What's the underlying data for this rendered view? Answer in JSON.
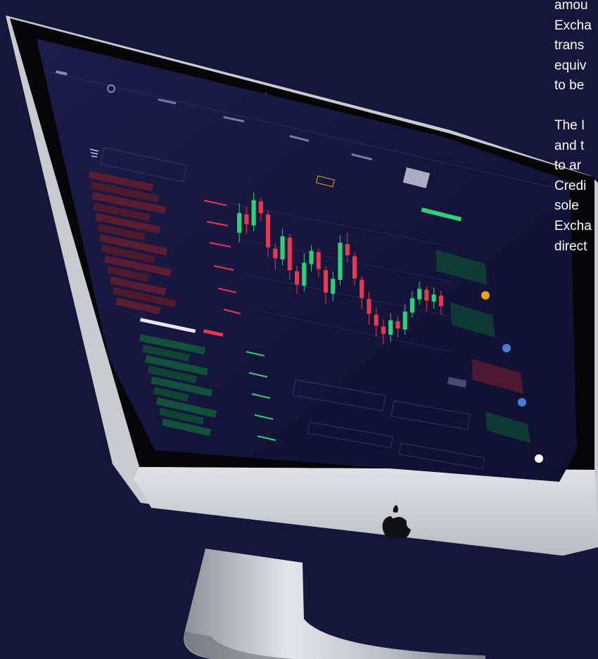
{
  "side_text": {
    "para1": [
      "amou",
      "Excha",
      "trans",
      "equiv",
      "to be"
    ],
    "para2": [
      "The I",
      "and t",
      "to ar",
      "Credi",
      "sole",
      "Excha",
      "direct"
    ]
  },
  "colors": {
    "background": "#16163a",
    "screen": "#121238",
    "bezel": "#0a0a0c",
    "chin": "#cfd3d8",
    "bull": "#2fd07a",
    "bear": "#e8384f",
    "accent": "#f0a020"
  },
  "chart_data": {
    "type": "candlestick",
    "candles": [
      {
        "o": 60,
        "c": 70,
        "h": 75,
        "l": 55
      },
      {
        "o": 70,
        "c": 65,
        "h": 74,
        "l": 60
      },
      {
        "o": 65,
        "c": 78,
        "h": 82,
        "l": 62
      },
      {
        "o": 78,
        "c": 72,
        "h": 80,
        "l": 68
      },
      {
        "o": 72,
        "c": 55,
        "h": 74,
        "l": 50
      },
      {
        "o": 55,
        "c": 50,
        "h": 58,
        "l": 44
      },
      {
        "o": 50,
        "c": 62,
        "h": 66,
        "l": 47
      },
      {
        "o": 62,
        "c": 45,
        "h": 64,
        "l": 40
      },
      {
        "o": 45,
        "c": 38,
        "h": 48,
        "l": 33
      },
      {
        "o": 38,
        "c": 50,
        "h": 55,
        "l": 35
      },
      {
        "o": 50,
        "c": 57,
        "h": 60,
        "l": 46
      },
      {
        "o": 57,
        "c": 48,
        "h": 59,
        "l": 44
      },
      {
        "o": 48,
        "c": 36,
        "h": 50,
        "l": 30
      },
      {
        "o": 36,
        "c": 44,
        "h": 48,
        "l": 32
      },
      {
        "o": 44,
        "c": 64,
        "h": 68,
        "l": 41
      },
      {
        "o": 64,
        "c": 58,
        "h": 70,
        "l": 54
      },
      {
        "o": 58,
        "c": 46,
        "h": 60,
        "l": 42
      },
      {
        "o": 46,
        "c": 36,
        "h": 48,
        "l": 30
      },
      {
        "o": 36,
        "c": 28,
        "h": 40,
        "l": 22
      },
      {
        "o": 28,
        "c": 22,
        "h": 32,
        "l": 16
      },
      {
        "o": 22,
        "c": 18,
        "h": 26,
        "l": 12
      },
      {
        "o": 18,
        "c": 26,
        "h": 30,
        "l": 14
      },
      {
        "o": 26,
        "c": 22,
        "h": 29,
        "l": 17
      },
      {
        "o": 22,
        "c": 32,
        "h": 36,
        "l": 19
      },
      {
        "o": 32,
        "c": 40,
        "h": 44,
        "l": 29
      },
      {
        "o": 40,
        "c": 46,
        "h": 50,
        "l": 37
      },
      {
        "o": 46,
        "c": 40,
        "h": 48,
        "l": 34
      },
      {
        "o": 40,
        "c": 44,
        "h": 48,
        "l": 36
      },
      {
        "o": 44,
        "c": 38,
        "h": 47,
        "l": 33
      }
    ]
  }
}
